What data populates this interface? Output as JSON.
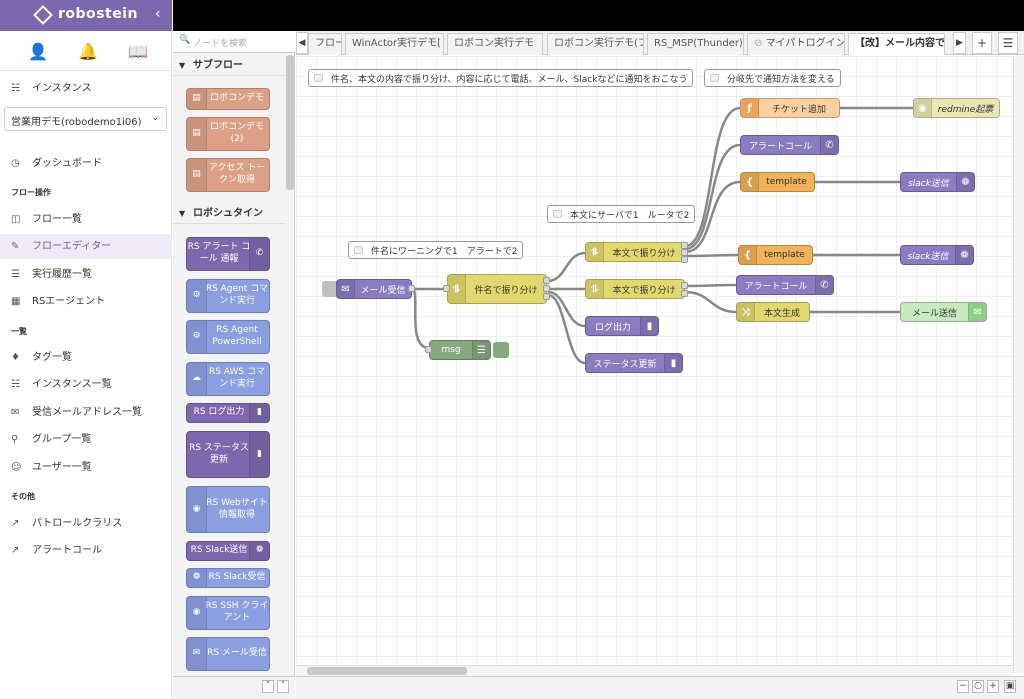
{
  "app": {
    "brand": "robostein",
    "collapse_icon": "‹"
  },
  "sidebar": {
    "instances_label": "インスタンス",
    "instance_select": "営業用デモ(robodemo1i06)",
    "dashboard": "ダッシュボード",
    "section_flow": "フロー操作",
    "flow_list": "フロー一覧",
    "flow_editor": "フローエディター",
    "exec_history": "実行履歴一覧",
    "rs_agent": "RSエージェント",
    "section_list": "一覧",
    "tag_list": "タグ一覧",
    "instance_list": "インスタンス一覧",
    "mail_list": "受信メールアドレス一覧",
    "group_list": "グループ一覧",
    "user_list": "ユーザー一覧",
    "section_other": "その他",
    "patrol": "パトロールクラリス",
    "alert_call": "アラートコール"
  },
  "palette": {
    "search_placeholder": "ノードを検索",
    "cat_subflow": "サブフロー",
    "cat_robo": "ロボシュタイン",
    "subflow_nodes": [
      "ロボコンデモ",
      "ロボコンデモ (2)",
      "アクセス トークン取得"
    ],
    "robo_nodes": [
      "RS アラート コール 通報",
      "RS Agent コマンド実行",
      "RS Agent PowerShell",
      "RS AWS コマンド実行",
      "RS ログ出力",
      "RS ステータス 更新",
      "RS Webサイト 情報取得",
      "RS Slack送信",
      "RS Slack受信",
      "RS SSH クライアント",
      "RS メール受信"
    ]
  },
  "tabs": [
    "フロー",
    "WinActor実行デモ[",
    "ロボコン実行デモ",
    "ロボコン実行デモ(フ",
    "RS_MSP(Thunder)",
    "マイパトログイン",
    "【改】メール内容で"
  ],
  "flow": {
    "comments": [
      "件名、本文の内容で振り分け、内容に応じて電話、メール、Slackなどに通知をおこなう",
      "分岐先で通知方法を変える",
      "本文にサーバで1　ルータで2",
      "件名にワーニングで1　アラートで2"
    ],
    "nodes": {
      "mail_in": "メール受信",
      "switch_subject": "件名で振り分け",
      "msg": "msg",
      "switch_body1": "本文で振り分け",
      "switch_body2": "本文で振り分け",
      "log": "ログ出力",
      "status": "ステータス更新",
      "ticket": "チケット追加",
      "alert1": "アラートコール",
      "template1": "template",
      "template2": "template",
      "alert2": "アラートコール",
      "body_gen": "本文生成",
      "redmine": "redmine起票",
      "slack1": "slack送信",
      "slack2": "slack送信",
      "mail_send": "メール送信"
    }
  },
  "colors": {
    "brand": "#7b68ad",
    "rs_purple": "#8b7bc0",
    "rs_blue": "#8a9ee0",
    "subflow": "#dca087",
    "switch": "#e2d96e",
    "function": "#fdd0a2",
    "template": "#f0b35a",
    "debug": "#87a980",
    "email": "#c7e9c0",
    "redmine": "#e9e7b4"
  }
}
